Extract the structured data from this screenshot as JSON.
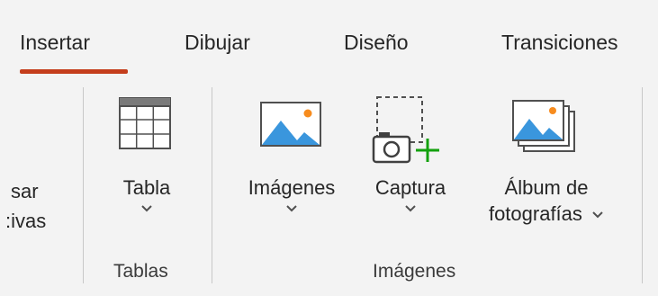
{
  "tabs": {
    "insertar": "Insertar",
    "dibujar": "Dibujar",
    "diseno": "Diseño",
    "transiciones": "Transiciones"
  },
  "left_cut": {
    "line1": "sar",
    "line2": ":ivas"
  },
  "groups": {
    "tablas": {
      "label": "Tablas",
      "tabla_button": "Tabla"
    },
    "imagenes": {
      "label": "Imágenes",
      "imagenes_button": "Imágenes",
      "captura_button": "Captura",
      "album_line1": "Álbum de",
      "album_line2": "fotografías"
    }
  },
  "colors": {
    "accent": "#c43e1c",
    "icon_blue": "#3a96dd",
    "icon_orange": "#f78c1e",
    "capture_green": "#13a10e",
    "ribbon_bg": "#f3f3f3",
    "separator": "#c8c8c8"
  },
  "icons": {
    "tabla": "table-grid-icon",
    "imagenes": "picture-icon",
    "captura": "screenshot-camera-icon",
    "album": "photo-album-icon"
  }
}
